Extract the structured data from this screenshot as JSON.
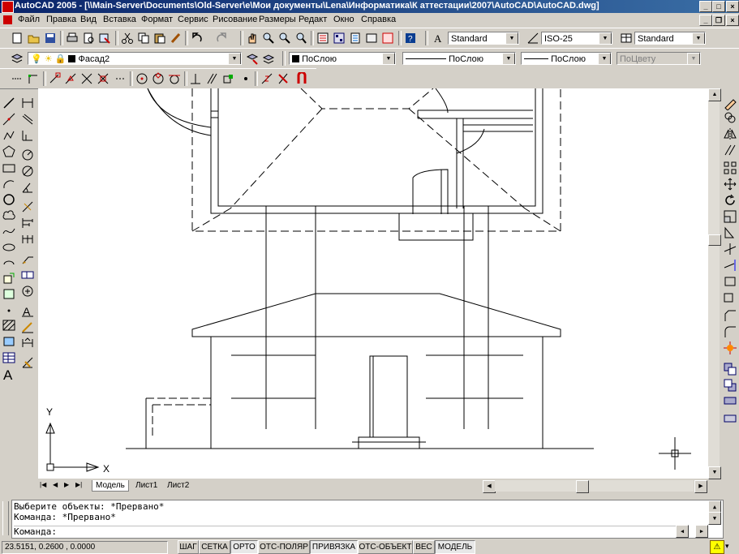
{
  "window": {
    "title": "AutoCAD 2005 - [\\\\Main-Server\\Documents\\Old-Server\\e\\Мои документы\\Lena\\Информатика\\К аттестации\\2007\\AutoCAD\\AutoCAD.dwg]",
    "min": "_",
    "max": "□",
    "close": "×"
  },
  "menu": [
    "Файл",
    "Правка",
    "Вид",
    "Вставка",
    "Формат",
    "Сервис",
    "Рисование",
    "Размеры",
    "Редакт",
    "Окно",
    "Справка"
  ],
  "toolbar": {
    "text_style": "Standard",
    "dim_style": "ISO-25",
    "table_style": "Standard"
  },
  "layers": {
    "current_layer": "Фасад2",
    "color": "ПоСлою",
    "linetype": "ПоСлою",
    "lineweight": "ПоСлою",
    "plot_style": "ПоЦвету"
  },
  "ucs": {
    "x_label": "X",
    "y_label": "Y"
  },
  "tabs": [
    "Модель",
    "Лист1",
    "Лист2"
  ],
  "command_lines": [
    "Выберите объекты: *Прервано*",
    "Команда: *Прервано*",
    "Команда:"
  ],
  "coords": "23.5151, 0.2600 , 0.0000",
  "status_buttons": [
    "ШАГ",
    "СЕТКА",
    "ОРТО",
    "ОТС-ПОЛЯР",
    "ПРИВЯЗКА",
    "ОТС-ОБЪЕКТ",
    "ВЕС",
    "МОДЕЛЬ"
  ],
  "status_active": [
    "ОРТО",
    "ПРИВЯЗКА",
    "МОДЕЛЬ"
  ]
}
